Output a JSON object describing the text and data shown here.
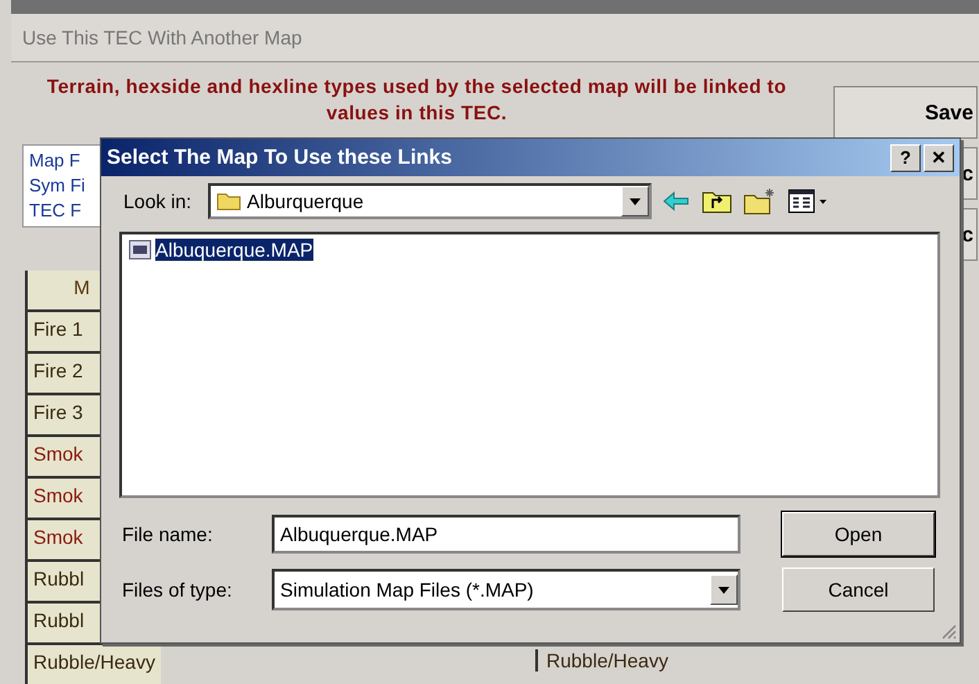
{
  "menu": {
    "title": "Use This TEC With Another Map"
  },
  "message": "Terrain, hexside and hexline types used by the selected map will be linked to values in this TEC.",
  "right_buttons": [
    "Save",
    "c",
    "c"
  ],
  "file_labels": [
    "Map F",
    "Sym Fi",
    "TEC F"
  ],
  "grid": {
    "header": "M",
    "rows": [
      {
        "label": "Fire 1",
        "color": "#3a2a10"
      },
      {
        "label": "Fire 2",
        "color": "#3a2a10"
      },
      {
        "label": "Fire 3",
        "color": "#3a2a10"
      },
      {
        "label": "Smok",
        "color": "#8a1a10"
      },
      {
        "label": "Smok",
        "color": "#8a1a10"
      },
      {
        "label": "Smok",
        "color": "#8a1a10"
      },
      {
        "label": "Rubbl",
        "color": "#3a2a10"
      },
      {
        "label": "Rubbl",
        "color": "#3a2a10"
      },
      {
        "label": "Rubble/Heavy",
        "color": "#3a2a10"
      }
    ],
    "second_column_row": "Rubble/Heavy"
  },
  "dialog": {
    "title": "Select The Map To Use these Links",
    "help": "?",
    "close": "✕",
    "look_in_label": "Look in:",
    "look_in_value": "Alburquerque",
    "files": [
      {
        "name": "Albuquerque.MAP",
        "selected": true
      }
    ],
    "file_name_label": "File name:",
    "file_name_value": "Albuquerque.MAP",
    "file_type_label": "Files of type:",
    "file_type_value": "Simulation Map Files (*.MAP)",
    "buttons": [
      "Open",
      "Cancel"
    ]
  }
}
